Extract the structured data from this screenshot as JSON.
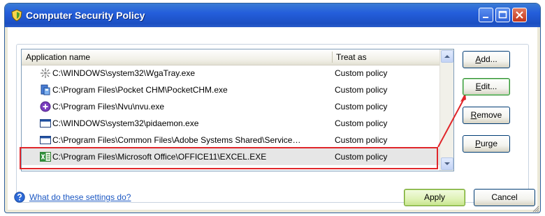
{
  "window": {
    "title": "Computer Security Policy"
  },
  "list": {
    "headers": {
      "app_name": "Application name",
      "treat_as": "Treat as"
    },
    "rows": [
      {
        "app": "C:\\WINDOWS\\system32\\WgaTray.exe",
        "treat": "Custom policy",
        "icon": "wga-tray-icon"
      },
      {
        "app": "C:\\Program Files\\Pocket CHM\\PocketCHM.exe",
        "treat": "Custom policy",
        "icon": "pocketchm-icon"
      },
      {
        "app": "C:\\Program Files\\Nvu\\nvu.exe",
        "treat": "Custom policy",
        "icon": "nvu-icon"
      },
      {
        "app": "C:\\WINDOWS\\system32\\pidaemon.exe",
        "treat": "Custom policy",
        "icon": "window-app-icon"
      },
      {
        "app": "C:\\Program Files\\Common Files\\Adobe Systems Shared\\Service…",
        "treat": "Custom policy",
        "icon": "window-app-icon"
      },
      {
        "app": "C:\\Program Files\\Microsoft Office\\OFFICE11\\EXCEL.EXE",
        "treat": "Custom policy",
        "icon": "excel-icon",
        "selected": true
      }
    ]
  },
  "buttons": {
    "add_prefix": "",
    "add_key": "A",
    "add_rest": "dd...",
    "edit_prefix": "",
    "edit_key": "E",
    "edit_rest": "dit...",
    "remove_prefix": "",
    "remove_key": "R",
    "remove_rest": "emove",
    "purge_prefix": "",
    "purge_key": "P",
    "purge_rest": "urge",
    "apply": "Apply",
    "cancel": "Cancel"
  },
  "help": {
    "link": "What do these settings do?"
  },
  "colors": {
    "titlebar": "#245edb",
    "highlight": "#e0262a",
    "link": "#1c58c3"
  }
}
